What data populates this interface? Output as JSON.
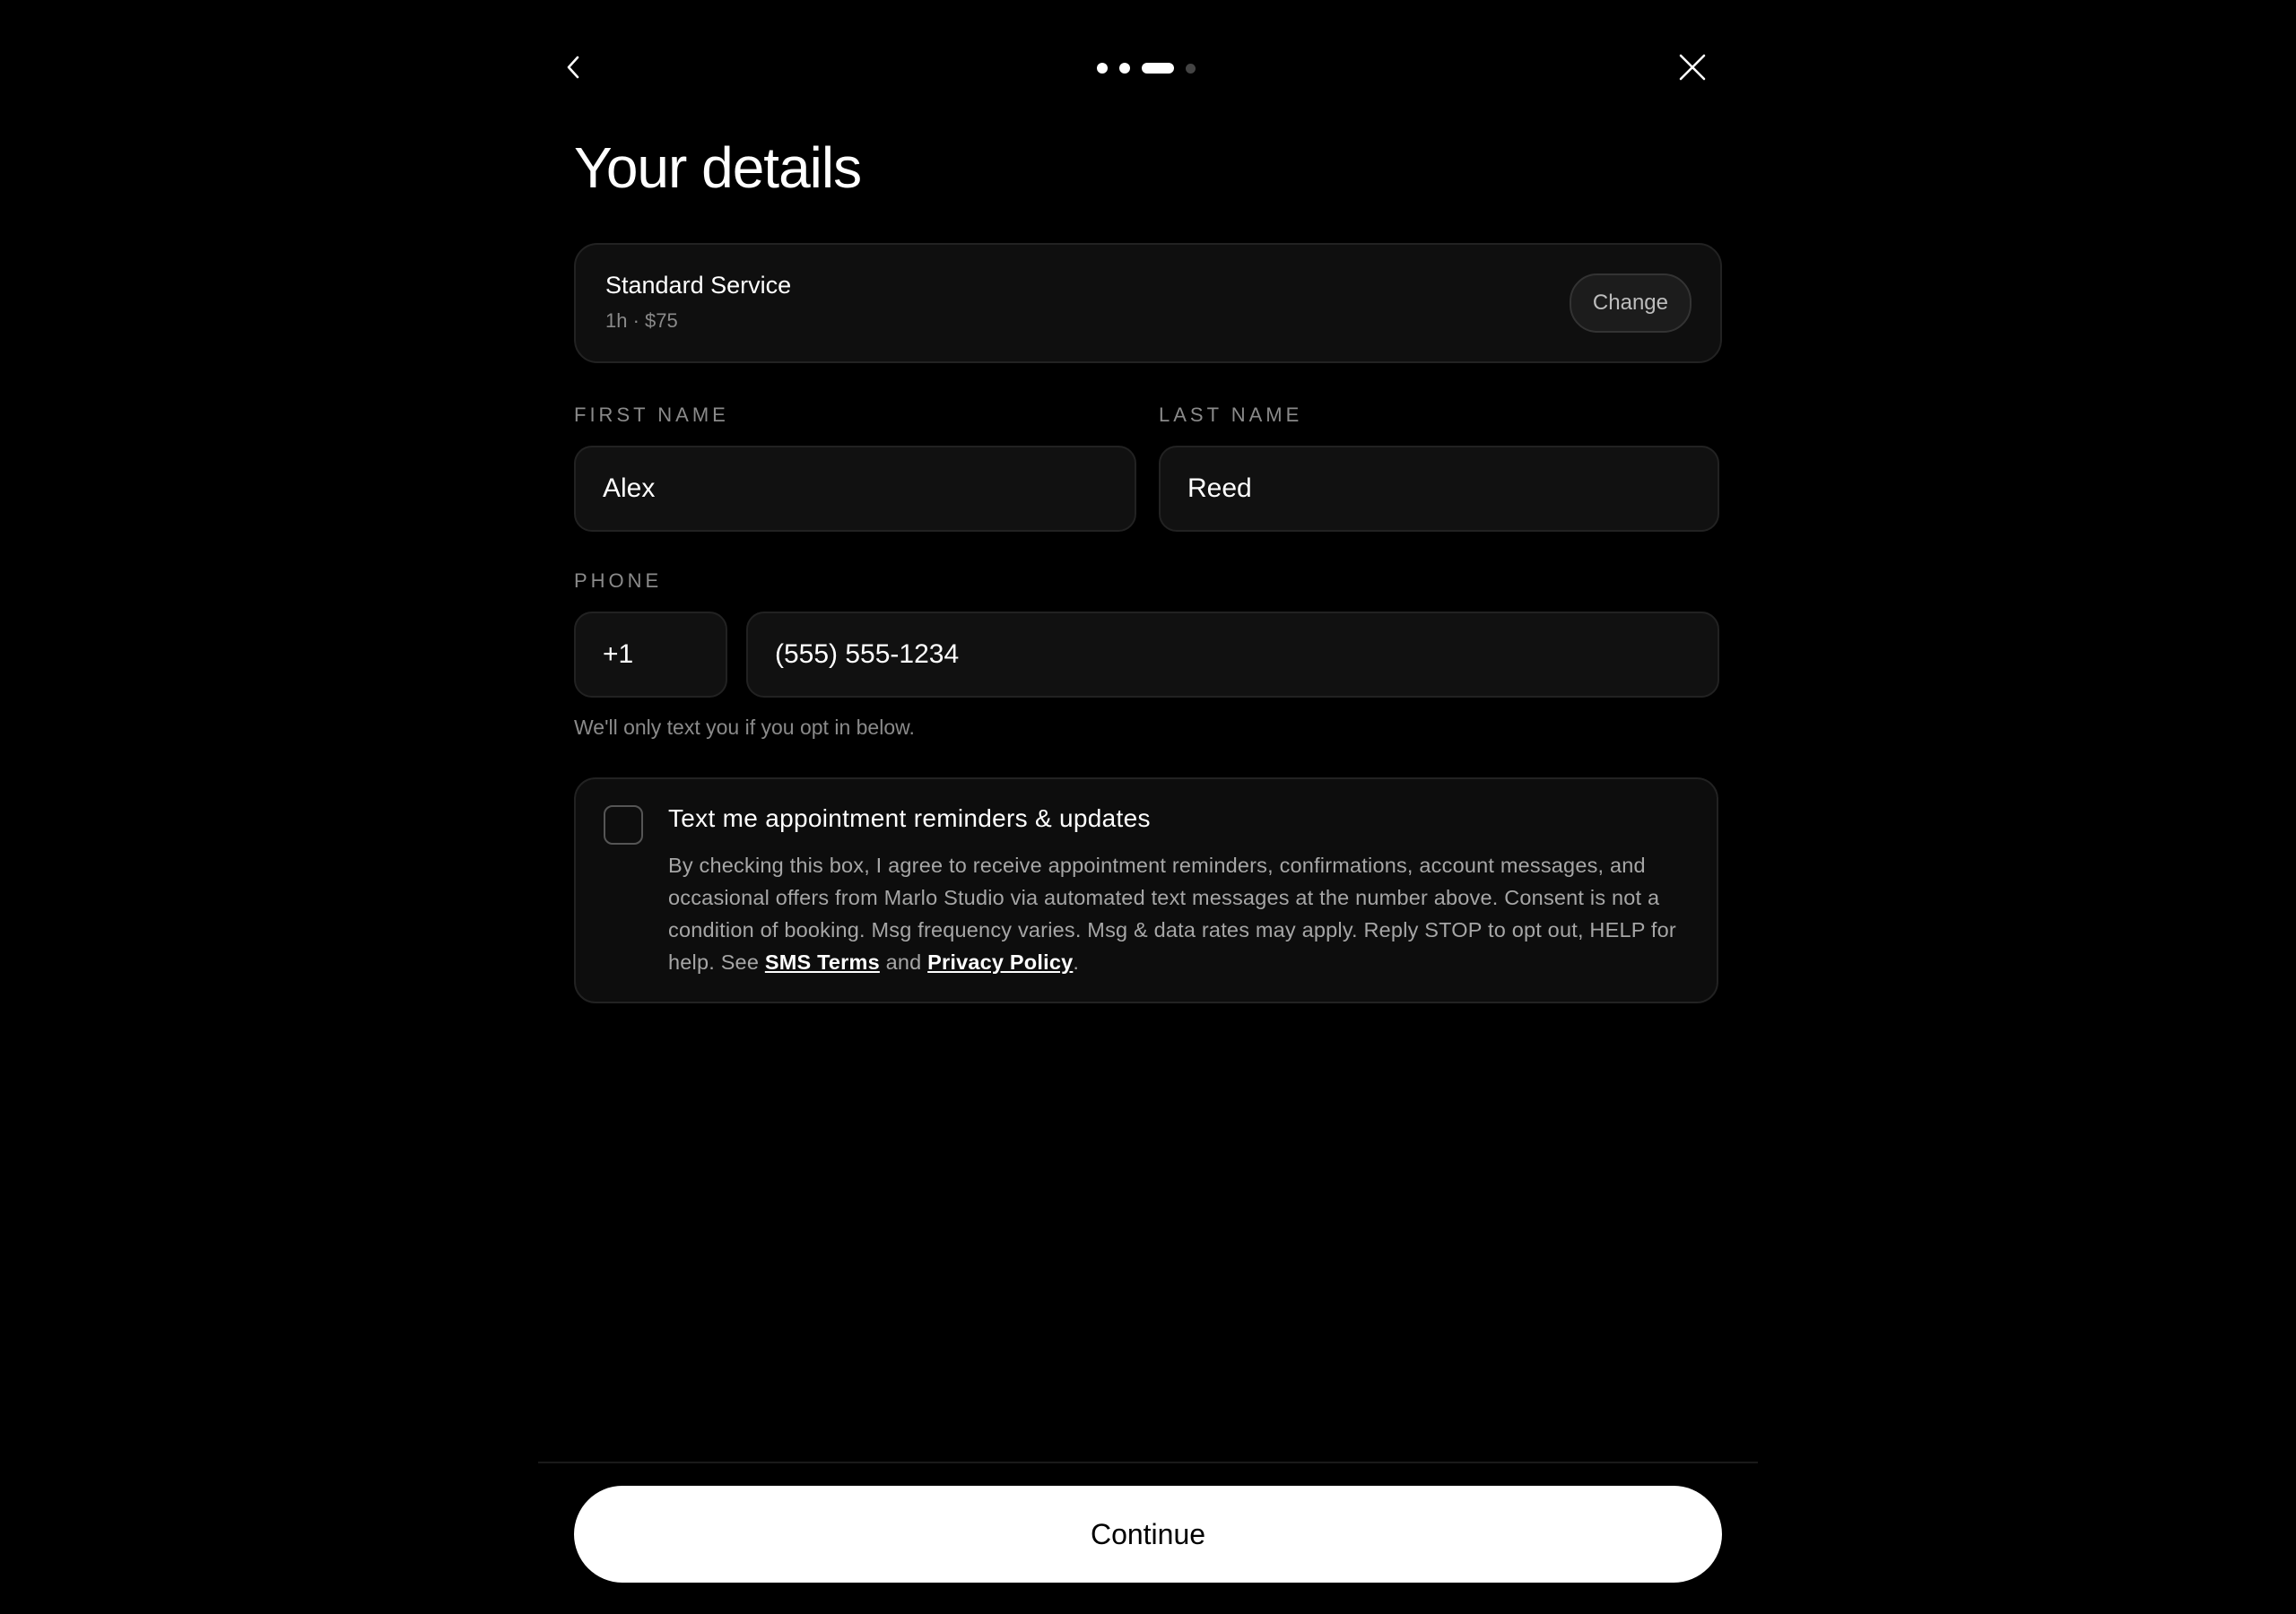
{
  "header": {
    "back_icon": "chevron-left-icon",
    "close_icon": "close-icon",
    "progress": {
      "total_steps": 4,
      "current_step": 3
    }
  },
  "page": {
    "title": "Your details"
  },
  "service": {
    "name": "Standard Service",
    "meta": "1h · $75",
    "change_label": "Change"
  },
  "form": {
    "first_name_label": "FIRST NAME",
    "first_name_value": "Alex",
    "last_name_label": "LAST NAME",
    "last_name_value": "Reed",
    "phone_label": "PHONE",
    "country_code": "+1",
    "phone_value": "(555) 555-1234",
    "helper_text": "We'll only text you if you opt in below."
  },
  "consent": {
    "checked": false,
    "title": "Text me appointment reminders & updates",
    "body_prefix": "By checking this box, I agree to receive appointment reminders, confirmations, account messages, and occasional offers from Marlo Studio via automated text messages at the number above. Consent is not a condition of booking. Msg frequency varies. Msg & data rates may apply. Reply STOP to opt out, HELP for help. See ",
    "sms_terms_label": "SMS Terms",
    "and_text": " and ",
    "privacy_label": "Privacy Policy",
    "suffix": "."
  },
  "footer": {
    "continue_label": "Continue"
  }
}
